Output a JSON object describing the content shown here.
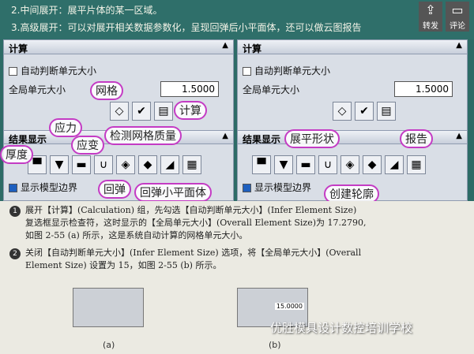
{
  "header": {
    "line1": "2.中间展开：展平片体的某一区域。",
    "line2": "3.高级展开：可以对展开相关数据参数化，呈现回弹后小平面体，还可以做云图报告",
    "share_label": "转发",
    "comment_label": "评论"
  },
  "panel_left": {
    "title": "计算",
    "auto_label": "自动判断单元大小",
    "global_label": "全局单元大小",
    "global_value": "1.5000",
    "section_title": "结果显示",
    "show_model_label": "显示模型边界",
    "annotations": {
      "mesh": "网格",
      "calc": "计算",
      "stress": "应力",
      "strain": "应变",
      "thickness": "厚度",
      "check_mesh": "检测网格质量",
      "springback": "回弹",
      "springback_facet": "回弹小平面体"
    }
  },
  "panel_right": {
    "title": "计算",
    "auto_label": "自动判断单元大小",
    "global_label": "全局单元大小",
    "global_value": "1.5000",
    "section_title": "结果显示",
    "show_model_label": "显示模型边界",
    "annotations": {
      "flatten": "展平形状",
      "report": "报告",
      "outline": "创建轮廓"
    }
  },
  "doc": {
    "p1_line1": "展开【计算】(Calculation) 组，先勾选【自动判断单元大小】(Infer Element Size)",
    "p1_line2": "复选框显示检查符，这时显示的【全局单元大小】(Overall Element Size)为 17.2790,",
    "p1_line3": "如图 2-55 (a) 所示，这是系统自动计算的网格单元大小。",
    "p2_line1": "关闭【自动判断单元大小】(Infer Element Size) 选项，将【全局单元大小】(Overall",
    "p2_line2": "Element Size) 设置为 15，如图 2-55 (b) 所示。",
    "cap_a": "(a)",
    "cap_b": "(b)",
    "mini_value": "15.0000",
    "watermark": "优胜模具设计数控培训学校"
  },
  "colors": {
    "accent": "#c43bc4",
    "teal": "#2f6f6a"
  }
}
